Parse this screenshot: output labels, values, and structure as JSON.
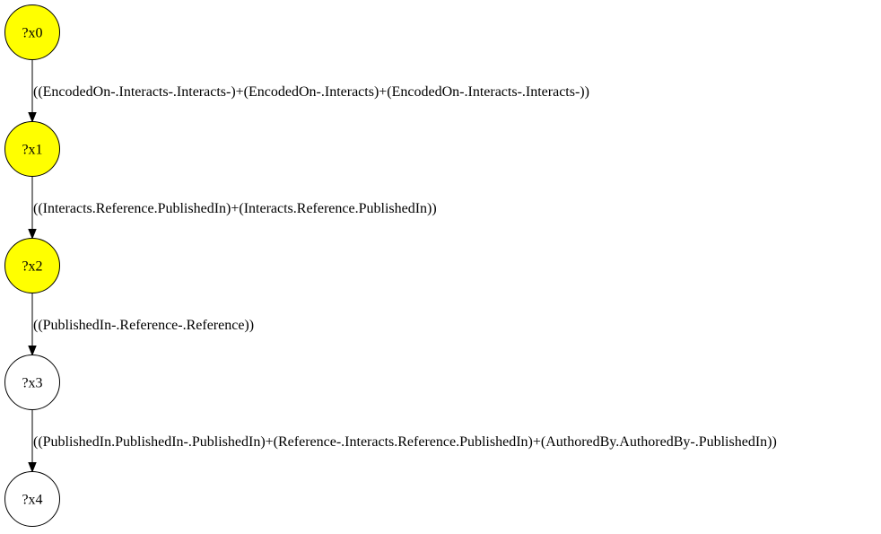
{
  "colors": {
    "highlight": "#ffff00",
    "plain": "#ffffff",
    "stroke": "#000000"
  },
  "nodes": [
    {
      "id": "x0",
      "label": "?x0",
      "highlighted": true
    },
    {
      "id": "x1",
      "label": "?x1",
      "highlighted": true
    },
    {
      "id": "x2",
      "label": "?x2",
      "highlighted": true
    },
    {
      "id": "x3",
      "label": "?x3",
      "highlighted": false
    },
    {
      "id": "x4",
      "label": "?x4",
      "highlighted": false
    }
  ],
  "edges": [
    {
      "from": "x0",
      "to": "x1",
      "label": "((EncodedOn-.Interacts-.Interacts-)+(EncodedOn-.Interacts)+(EncodedOn-.Interacts-.Interacts-))"
    },
    {
      "from": "x1",
      "to": "x2",
      "label": "((Interacts.Reference.PublishedIn)+(Interacts.Reference.PublishedIn))"
    },
    {
      "from": "x2",
      "to": "x3",
      "label": "((PublishedIn-.Reference-.Reference))"
    },
    {
      "from": "x3",
      "to": "x4",
      "label": "((PublishedIn.PublishedIn-.PublishedIn)+(Reference-.Interacts.Reference.PublishedIn)+(AuthoredBy.AuthoredBy-.PublishedIn))"
    }
  ]
}
